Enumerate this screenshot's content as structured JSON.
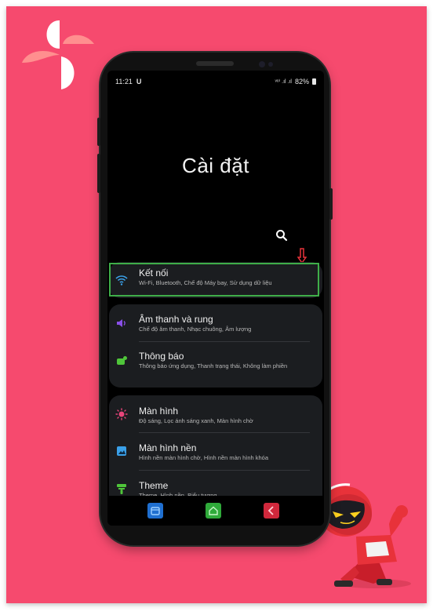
{
  "status_bar": {
    "time": "11:21",
    "signal_text": "ᵛᵒ⁾ .ıl .ıl",
    "battery": "82%"
  },
  "page_title": "Cài đặt",
  "sections": [
    [
      {
        "key": "ket-noi",
        "label": "Kết nối",
        "sub": "Wi-Fi, Bluetooth, Chế độ Máy bay, Sử dụng dữ liệu",
        "icon": "wifi-icon",
        "color": "#3aa0e8"
      }
    ],
    [
      {
        "key": "am-thanh",
        "label": "Âm thanh và rung",
        "sub": "Chế độ âm thanh, Nhạc chuông, Âm lượng",
        "icon": "speaker-icon",
        "color": "#8a4fe8"
      },
      {
        "key": "thong-bao",
        "label": "Thông báo",
        "sub": "Thông báo ứng dụng, Thanh trạng thái, Không làm phiền",
        "icon": "notification-icon",
        "color": "#4fc53a"
      }
    ],
    [
      {
        "key": "man-hinh",
        "label": "Màn hình",
        "sub": "Độ sáng, Lọc ánh sáng xanh, Màn hình chờ",
        "icon": "brightness-icon",
        "color": "#e8457a"
      },
      {
        "key": "man-hinh-nen",
        "label": "Màn hình nền",
        "sub": "Hình nền màn hình chờ, Hình nền màn hình khóa",
        "icon": "wallpaper-icon",
        "color": "#3aa0e8"
      },
      {
        "key": "theme",
        "label": "Theme",
        "sub": "Theme, Hình nền, Biểu tượng",
        "icon": "theme-brush-icon",
        "color": "#4fc53a"
      }
    ]
  ],
  "colors": {
    "background": "#f64a6e",
    "highlight": "#3fae49",
    "arrow": "#e8323a"
  }
}
